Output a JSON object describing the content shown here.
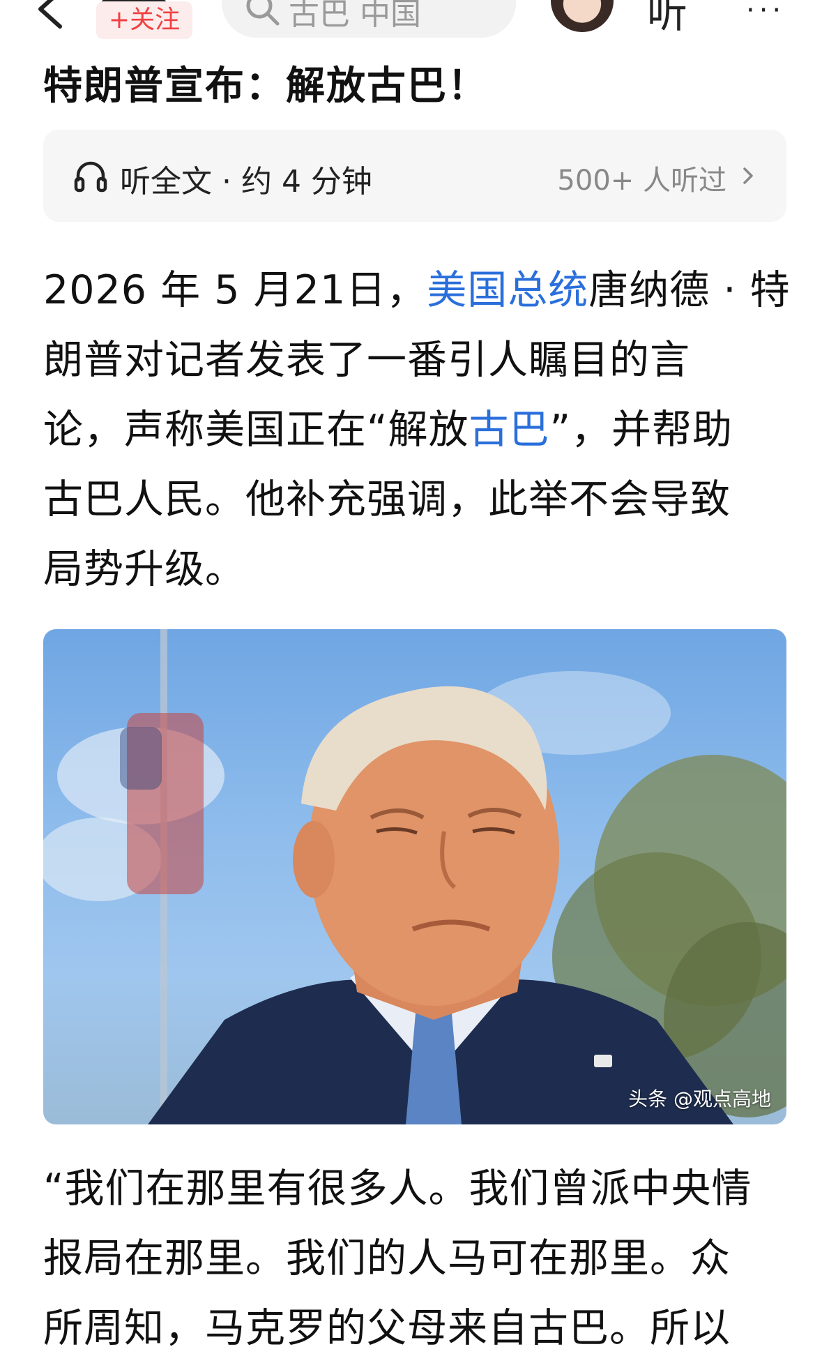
{
  "topbar": {
    "follow_label": "+关注",
    "search_placeholder": "古巴 中国",
    "listen_label": "听",
    "more_label": "···"
  },
  "article": {
    "headline": "特朗普宣布：解放古巴！",
    "listen_card": {
      "label": "听全文 · 约 4 分钟",
      "count": "500+ 人听过"
    },
    "para1": {
      "l1_a": "2026 年 5 月21日，",
      "l1_link": "美国总统",
      "l1_b": "唐纳德 · 特",
      "l2": "朗普对记者发表了一番引人瞩目的言",
      "l3_a": "论，声称美国正在“解放",
      "l3_link": "古巴",
      "l3_b": "”，并帮助",
      "l4": "古巴人民。他补充强调，此举不会导致",
      "l5": "局势升级。"
    },
    "photo": {
      "watermark": "头条 @观点高地"
    },
    "para2": {
      "l1": "“我们在那里有很多人。我们曾派中央情",
      "l2": "报局在那里。我们的人马可在那里。众",
      "l3": "所周知，马克罗的父母来自古巴。所以"
    }
  },
  "colors": {
    "link": "#2a6fdb",
    "follow": "#f04142",
    "card_bg": "#f6f6f6"
  }
}
